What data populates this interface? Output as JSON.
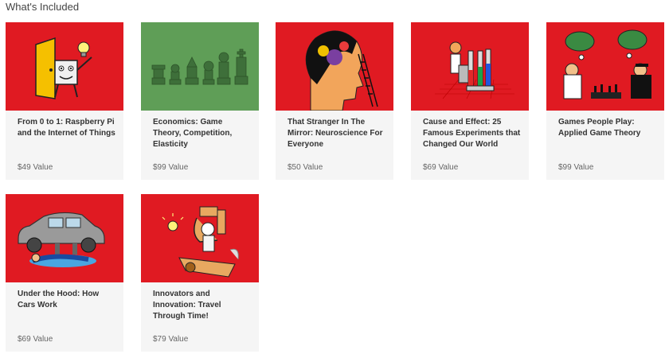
{
  "section": {
    "title": "What's Included"
  },
  "colors": {
    "red": "#e01a22",
    "green": "#5f9e57",
    "card_bg": "#f5f5f5"
  },
  "courses": [
    {
      "title": "From 0 to 1: Raspberry Pi and the Internet of Things",
      "value": "$49 Value",
      "image": "cartoon-robot-door"
    },
    {
      "title": "Economics: Game Theory, Competition, Elasticity",
      "value": "$99 Value",
      "image": "chess-pieces"
    },
    {
      "title": "That Stranger In The Mirror: Neuroscience For Everyone",
      "value": "$50 Value",
      "image": "brain-head"
    },
    {
      "title": "Cause and Effect: 25 Famous Experiments that Changed Our World",
      "value": "$69 Value",
      "image": "lab-experiment"
    },
    {
      "title": "Games People Play: Applied Game Theory",
      "value": "$99 Value",
      "image": "chess-players"
    },
    {
      "title": "Under the Hood: How Cars Work",
      "value": "$69 Value",
      "image": "car-mechanic"
    },
    {
      "title": "Innovators and Innovation: Travel Through Time!",
      "value": "$79 Value",
      "image": "time-machine"
    }
  ]
}
